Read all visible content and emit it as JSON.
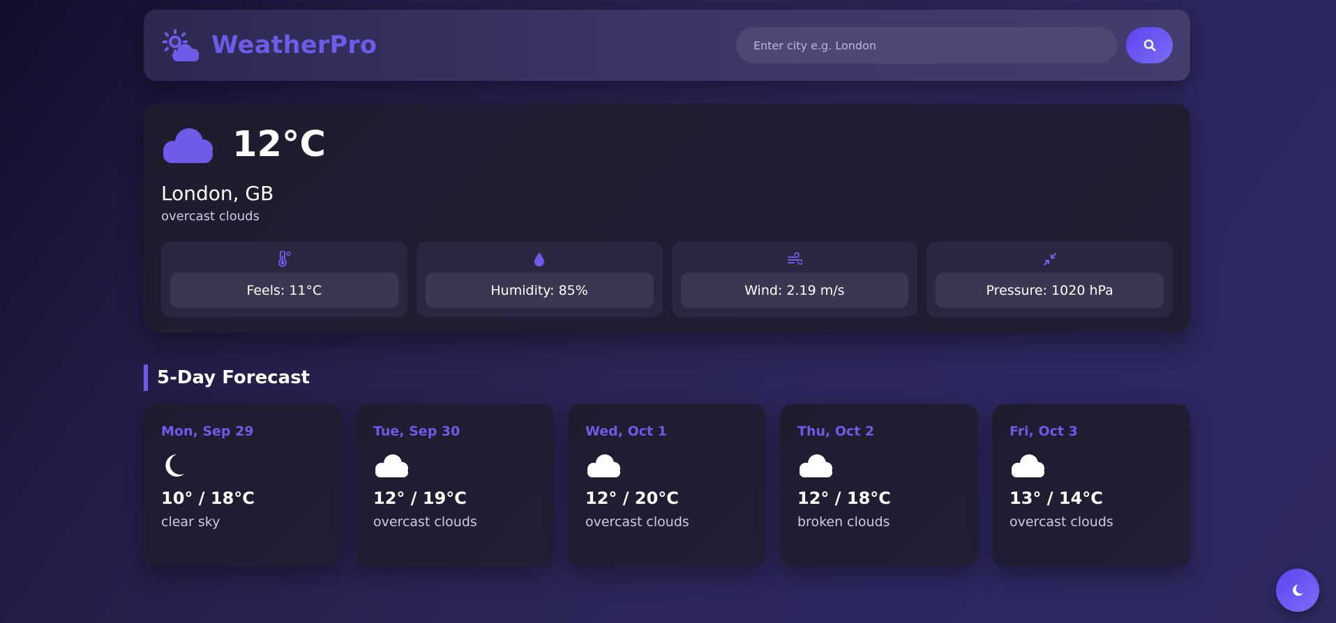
{
  "app": {
    "name": "WeatherPro",
    "logo_icon": "sun-cloud-icon",
    "accent_color": "#6c5ce7"
  },
  "search": {
    "placeholder": "Enter city e.g. London",
    "value": "",
    "button_icon": "search-icon"
  },
  "current": {
    "icon": "cloud-icon",
    "temperature": "12°C",
    "location": "London, GB",
    "description": "overcast clouds",
    "stats": [
      {
        "icon": "thermometer-icon",
        "text": "Feels: 11°C"
      },
      {
        "icon": "droplet-icon",
        "text": "Humidity: 85%"
      },
      {
        "icon": "wind-icon",
        "text": "Wind: 2.19 m/s"
      },
      {
        "icon": "compress-icon",
        "text": "Pressure: 1020 hPa"
      }
    ]
  },
  "forecast": {
    "title": "5-Day Forecast",
    "days": [
      {
        "date": "Mon, Sep 29",
        "icon": "moon-icon",
        "temps": "10° / 18°C",
        "description": "clear sky"
      },
      {
        "date": "Tue, Sep 30",
        "icon": "cloud-icon",
        "temps": "12° / 19°C",
        "description": "overcast clouds"
      },
      {
        "date": "Wed, Oct 1",
        "icon": "cloud-icon",
        "temps": "12° / 20°C",
        "description": "overcast clouds"
      },
      {
        "date": "Thu, Oct 2",
        "icon": "cloud-icon",
        "temps": "12° / 18°C",
        "description": "broken clouds"
      },
      {
        "date": "Fri, Oct 3",
        "icon": "cloud-icon",
        "temps": "13° / 14°C",
        "description": "overcast clouds"
      }
    ]
  },
  "theme_toggle": {
    "icon": "moon-icon"
  }
}
